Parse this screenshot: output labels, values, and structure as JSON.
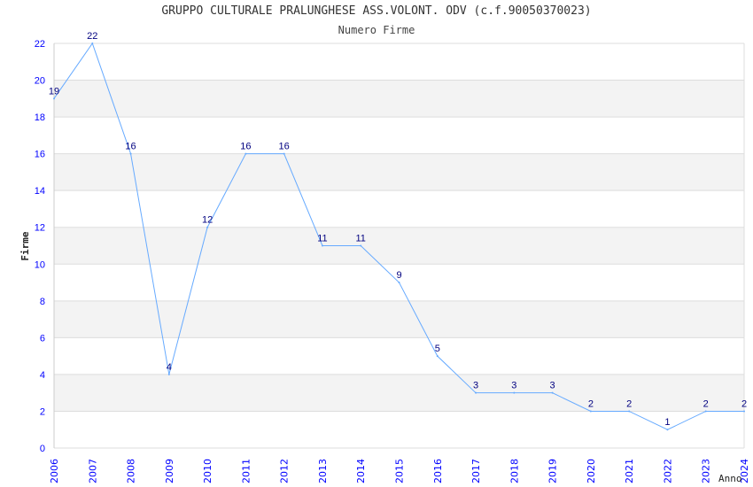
{
  "chart_data": {
    "type": "line",
    "title": "GRUPPO CULTURALE PRALUNGHESE ASS.VOLONT. ODV (c.f.90050370023)",
    "subtitle": "Numero Firme",
    "xlabel": "Anno",
    "ylabel": "Firme",
    "ylim": [
      0,
      22
    ],
    "yticks": [
      0,
      2,
      4,
      6,
      8,
      10,
      12,
      14,
      16,
      18,
      20,
      22
    ],
    "grid": true,
    "x": [
      "2006",
      "2007",
      "2008",
      "2009",
      "2010",
      "2011",
      "2012",
      "2013",
      "2014",
      "2015",
      "2016",
      "2017",
      "2018",
      "2019",
      "2020",
      "2021",
      "2022",
      "2023",
      "2024"
    ],
    "series": [
      {
        "values": [
          19,
          22,
          16,
          4,
          12,
          16,
          16,
          11,
          11,
          9,
          5,
          3,
          3,
          3,
          2,
          2,
          1,
          2,
          2
        ]
      }
    ],
    "colors": {
      "line": "#66aaff",
      "tick_labels": "#0000ff",
      "data_labels": "#000080",
      "band": "#f3f3f3",
      "grid": "#dddddd"
    }
  }
}
